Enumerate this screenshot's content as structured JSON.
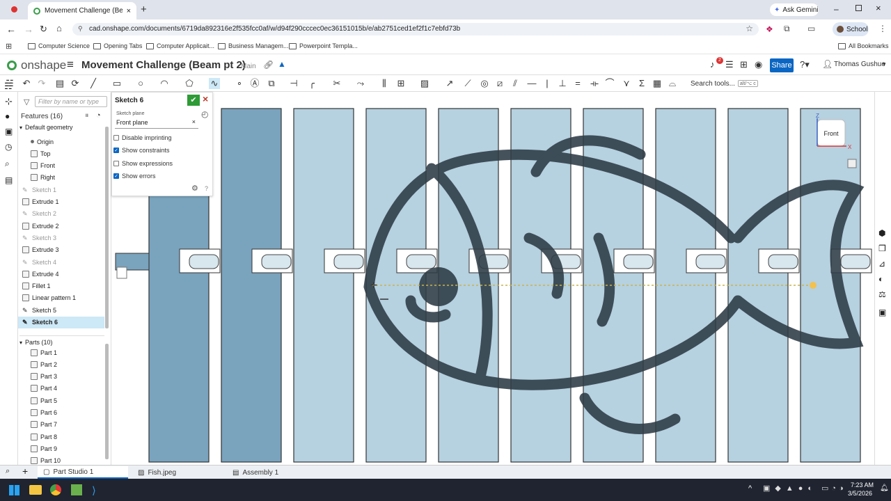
{
  "browser": {
    "tab_title": "Movement Challenge (Beam pt",
    "url": "cad.onshape.com/documents/6719da892316e2f535fcc0af/w/d94f290cccec0ec36151015b/e/ab2751ced1ef2f1c7ebfd73b",
    "ask_gemini": "Ask Gemini",
    "profile": "School",
    "bookmarks": [
      "Computer Science",
      "Opening Tabs",
      "Computer Applicait...",
      "Business Managem...",
      "Powerpoint Templa..."
    ],
    "all_bookmarks": "All Bookmarks"
  },
  "app": {
    "logo": "onshape",
    "doc_title": "Movement Challenge (Beam pt 2)",
    "branch": "Main",
    "share": "Share",
    "user": "Thomas Gushue",
    "notif_count": "2",
    "search_tools": "Search tools...",
    "shortcut": "alt/⌥ c"
  },
  "features": {
    "filter_placeholder": "Filter by name or type",
    "header": "Features (16)",
    "default_geometry": "Default geometry",
    "items": [
      {
        "label": "Origin",
        "indent": 2,
        "kind": "origin"
      },
      {
        "label": "Top",
        "indent": 2,
        "kind": "plane"
      },
      {
        "label": "Front",
        "indent": 2,
        "kind": "plane"
      },
      {
        "label": "Right",
        "indent": 2,
        "kind": "plane"
      },
      {
        "label": "Sketch 1",
        "indent": 1,
        "kind": "sketch-hidden"
      },
      {
        "label": "Extrude 1",
        "indent": 1,
        "kind": "feature"
      },
      {
        "label": "Sketch 2",
        "indent": 1,
        "kind": "sketch-hidden"
      },
      {
        "label": "Extrude 2",
        "indent": 1,
        "kind": "feature"
      },
      {
        "label": "Sketch 3",
        "indent": 1,
        "kind": "sketch-hidden"
      },
      {
        "label": "Extrude 3",
        "indent": 1,
        "kind": "feature"
      },
      {
        "label": "Sketch 4",
        "indent": 1,
        "kind": "sketch-hidden"
      },
      {
        "label": "Extrude 4",
        "indent": 1,
        "kind": "feature"
      },
      {
        "label": "Fillet 1",
        "indent": 1,
        "kind": "feature"
      },
      {
        "label": "Linear pattern 1",
        "indent": 1,
        "kind": "feature"
      },
      {
        "label": "Sketch 5",
        "indent": 1,
        "kind": "sketch"
      },
      {
        "label": "Sketch 6",
        "indent": 1,
        "kind": "sketch-selected"
      }
    ],
    "parts_header": "Parts (10)",
    "parts": [
      "Part 1",
      "Part 2",
      "Part 3",
      "Part 4",
      "Part 5",
      "Part 6",
      "Part 7",
      "Part 8",
      "Part 9",
      "Part 10"
    ]
  },
  "sketch_panel": {
    "title": "Sketch 6",
    "plane_label": "Sketch plane",
    "plane_value": "Front plane",
    "options": [
      {
        "label": "Disable imprinting",
        "checked": false
      },
      {
        "label": "Show constraints",
        "checked": true
      },
      {
        "label": "Show expressions",
        "checked": false
      },
      {
        "label": "Show errors",
        "checked": true
      }
    ]
  },
  "view_cube": {
    "label": "Front",
    "z": "Z",
    "x": "X"
  },
  "bottom_tabs": [
    "Part Studio 1",
    "Fish.jpeg",
    "Assembly 1"
  ],
  "taskbar": {
    "time": "7:23 AM",
    "date": "3/5/2026"
  },
  "colors": {
    "accent": "#0b66c3",
    "beam": "#b6d1e0",
    "beam_dark": "#7aa3bd",
    "selected": "#cde8f6",
    "ok": "#2e9b36",
    "cancel": "#c0392b"
  }
}
